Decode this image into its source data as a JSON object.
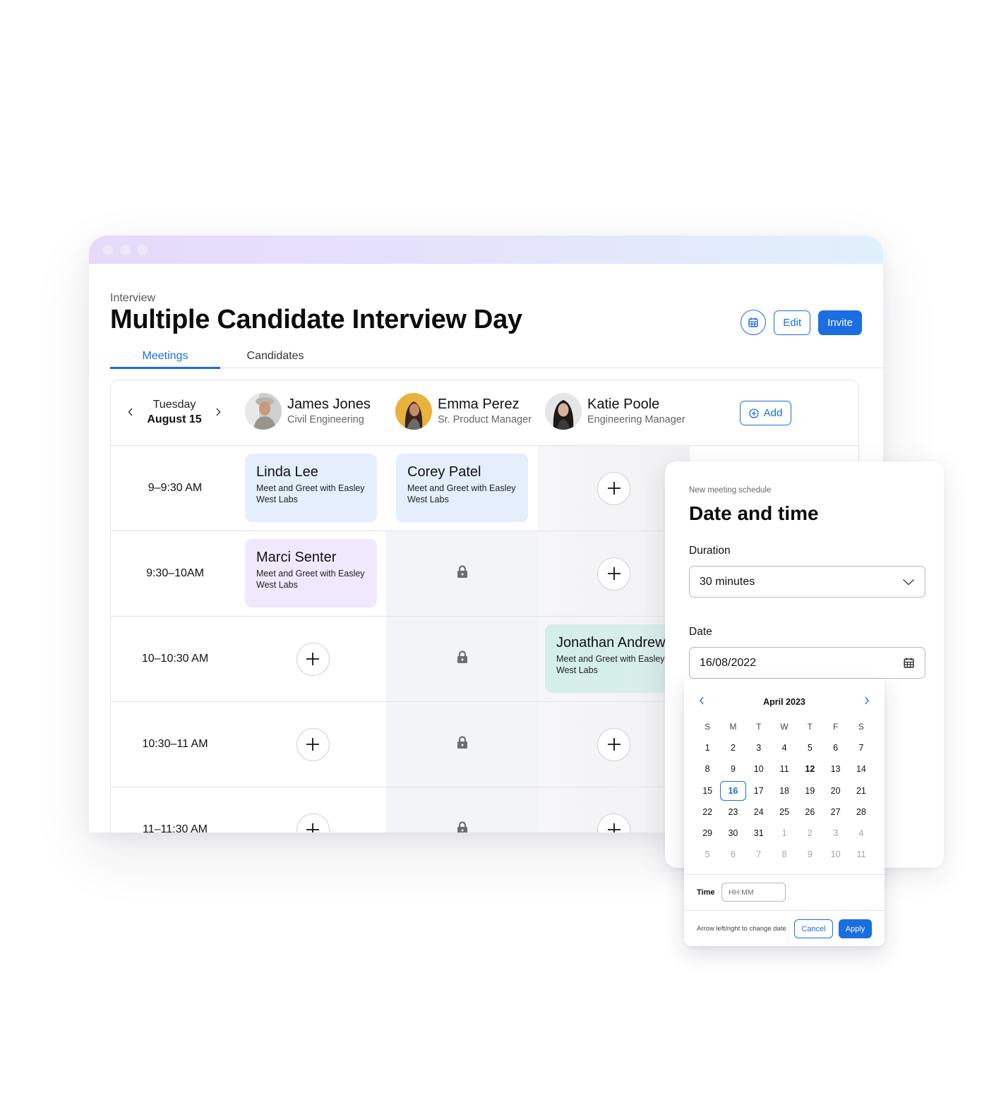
{
  "window": {
    "breadcrumb": "Interview",
    "title": "Multiple Candidate Interview Day",
    "actions": {
      "calendar_icon": "calendar-icon",
      "edit_label": "Edit",
      "invite_label": "Invite"
    },
    "tabs": [
      {
        "label": "Meetings",
        "active": true
      },
      {
        "label": "Candidates",
        "active": false
      }
    ]
  },
  "schedule": {
    "date": {
      "day": "Tuesday",
      "date": "August 15"
    },
    "interviewers": [
      {
        "name": "James Jones",
        "role": "Civil Engineering"
      },
      {
        "name": "Emma Perez",
        "role": "Sr. Product Manager"
      },
      {
        "name": "Katie Poole",
        "role": "Engineering Manager"
      }
    ],
    "add_label": "Add",
    "rows": [
      {
        "time": "9–9:30 AM",
        "cells": [
          {
            "type": "meeting",
            "name": "Linda Lee",
            "desc": "Meet and Greet with Easley West Labs",
            "color": "#e4eefc"
          },
          {
            "type": "meeting",
            "name": "Corey Patel",
            "desc": "Meet and Greet with Easley West Labs",
            "color": "#e4eefc"
          },
          {
            "type": "add"
          }
        ]
      },
      {
        "time": "9:30–10AM",
        "cells": [
          {
            "type": "meeting",
            "name": "Marci Senter",
            "desc": "Meet and Greet with Easley West Labs",
            "color": "#f0e8fc"
          },
          {
            "type": "locked"
          },
          {
            "type": "add"
          }
        ]
      },
      {
        "time": "10–10:30 AM",
        "cells": [
          {
            "type": "add"
          },
          {
            "type": "locked"
          },
          {
            "type": "meeting",
            "name": "Jonathan Andrews",
            "desc": "Meet and Greet with Easley West Labs",
            "color": "#d4efe9"
          }
        ]
      },
      {
        "time": "10:30–11 AM",
        "cells": [
          {
            "type": "add"
          },
          {
            "type": "locked"
          },
          {
            "type": "add"
          }
        ]
      },
      {
        "time": "11–11:30 AM",
        "cells": [
          {
            "type": "add"
          },
          {
            "type": "locked"
          },
          {
            "type": "add"
          }
        ]
      }
    ]
  },
  "panel": {
    "subtitle": "New meeting schedule",
    "title": "Date and time",
    "duration_label": "Duration",
    "duration_value": "30 minutes",
    "date_label": "Date",
    "date_value": "16/08/2022"
  },
  "calendar": {
    "month": "April 2023",
    "weekdays": [
      "S",
      "M",
      "T",
      "W",
      "T",
      "F",
      "S"
    ],
    "days": [
      {
        "d": "1"
      },
      {
        "d": "2"
      },
      {
        "d": "3"
      },
      {
        "d": "4"
      },
      {
        "d": "5"
      },
      {
        "d": "6"
      },
      {
        "d": "7"
      },
      {
        "d": "8"
      },
      {
        "d": "9"
      },
      {
        "d": "10"
      },
      {
        "d": "11"
      },
      {
        "d": "12",
        "bold": true
      },
      {
        "d": "13"
      },
      {
        "d": "14"
      },
      {
        "d": "15"
      },
      {
        "d": "16",
        "selected": true
      },
      {
        "d": "17"
      },
      {
        "d": "18"
      },
      {
        "d": "19"
      },
      {
        "d": "20"
      },
      {
        "d": "21"
      },
      {
        "d": "22"
      },
      {
        "d": "23"
      },
      {
        "d": "24"
      },
      {
        "d": "25"
      },
      {
        "d": "26"
      },
      {
        "d": "27"
      },
      {
        "d": "28"
      },
      {
        "d": "29"
      },
      {
        "d": "30"
      },
      {
        "d": "31"
      },
      {
        "d": "1",
        "muted": true
      },
      {
        "d": "2",
        "muted": true
      },
      {
        "d": "3",
        "muted": true
      },
      {
        "d": "4",
        "muted": true
      },
      {
        "d": "5",
        "muted": true
      },
      {
        "d": "6",
        "muted": true
      },
      {
        "d": "7",
        "muted": true
      },
      {
        "d": "8",
        "muted": true
      },
      {
        "d": "9",
        "muted": true
      },
      {
        "d": "10",
        "muted": true
      },
      {
        "d": "11",
        "muted": true
      }
    ],
    "time_label": "Time",
    "time_placeholder": "HH:MM",
    "hint": "Arrow left/right to change date",
    "cancel_label": "Cancel",
    "apply_label": "Apply"
  },
  "colors": {
    "accent": "#1a6ee0",
    "locked_bg": "#f3f4f7"
  }
}
